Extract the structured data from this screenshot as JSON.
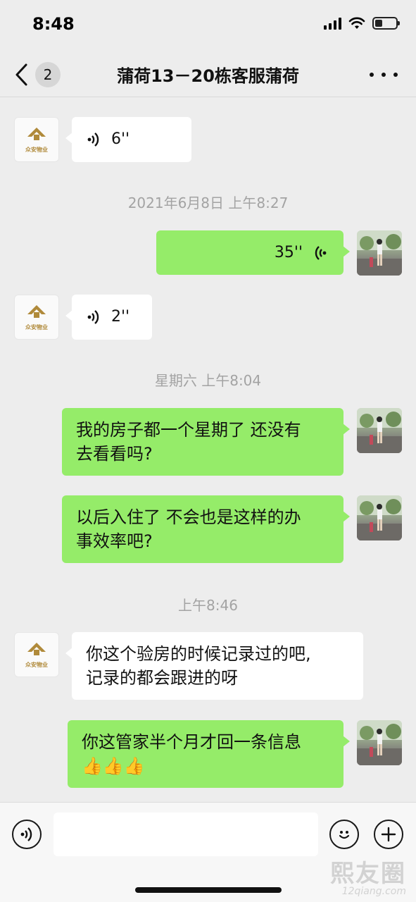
{
  "status_bar": {
    "time": "8:48"
  },
  "nav": {
    "unread_count": "2",
    "title": "蒲荷13－20栋客服蒲荷"
  },
  "messages": [
    {
      "side": "left",
      "type": "voice",
      "duration": "6''"
    },
    {
      "type": "timestamp",
      "text": "2021年6月8日 上午8:27"
    },
    {
      "side": "right",
      "type": "voice",
      "duration": "35''"
    },
    {
      "side": "left",
      "type": "voice",
      "duration": "2''"
    },
    {
      "type": "timestamp",
      "text": "星期六 上午8:04"
    },
    {
      "side": "right",
      "type": "text",
      "lines": [
        "我的房子都一个星期了 还没有",
        "去看看吗?"
      ]
    },
    {
      "side": "right",
      "type": "text",
      "lines": [
        "以后入住了 不会也是这样的办",
        "事效率吧?"
      ]
    },
    {
      "type": "timestamp",
      "text": "上午8:46"
    },
    {
      "side": "left",
      "type": "text",
      "lines": [
        "你这个验房的时候记录过的吧,",
        "记录的都会跟进的呀"
      ]
    },
    {
      "side": "right",
      "type": "text",
      "lines": [
        "你这管家半个月才回一条信息",
        "👍👍👍"
      ]
    }
  ],
  "logo": {
    "text": "众安物业"
  },
  "input_bar": {
    "placeholder": ""
  },
  "watermark": {
    "main": "熙友圈",
    "sub": "12qiang.com"
  },
  "colors": {
    "background": "#ededed",
    "incoming_bubble": "#ffffff",
    "outgoing_bubble": "#95ec69",
    "timestamp": "#a3a3a3"
  }
}
